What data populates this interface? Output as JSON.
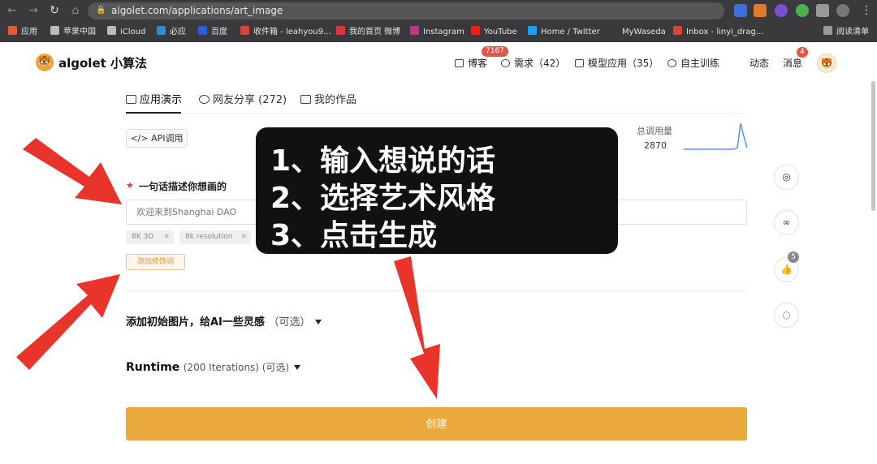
{
  "browser": {
    "url": "algolet.com/applications/art_image",
    "bookmarks": [
      "应用",
      "苹果中国",
      "iCloud",
      "必应",
      "百度",
      "收件箱 - leahyou9...",
      "我的首页 微博",
      "Instagram",
      "YouTube",
      "Home / Twitter",
      "MyWaseda",
      "Inbox - linyi_drag...",
      "阅读清单"
    ]
  },
  "header": {
    "brand": "algolet 小算法",
    "nav": {
      "blog": "博客",
      "blog_badge": "7167",
      "demand": "需求（42）",
      "models": "模型应用（35）",
      "training": "自主训练",
      "activity": "动态",
      "messages": "消息",
      "messages_badge": "4"
    }
  },
  "tabs": {
    "demo": "应用演示",
    "share": "网友分享 (272)",
    "works": "我的作品"
  },
  "api_button": "API调用",
  "usage": {
    "label": "总调用量",
    "value": "2870"
  },
  "form": {
    "required_mark": "★",
    "prompt_label": "一句话描述你想画的",
    "prompt_value": "欢迎来到Shanghai DAO",
    "chips": [
      "8K 3D",
      "8k resolution"
    ],
    "chip_close": "×",
    "add_modifier": "添加修饰词",
    "init_image_label": "添加初始图片，给AI一些灵感",
    "init_image_optional": "（可选）",
    "runtime_label": "Runtime",
    "runtime_detail": "(200 Iterations) (可选)",
    "create_button": "创建"
  },
  "side": {
    "like_count": "5"
  },
  "overlay": {
    "line1": "1、输入想说的话",
    "line2": "2、选择艺术风格",
    "line3": "3、点击生成"
  },
  "colors": {
    "accent": "#e9a93d",
    "arrow": "#e8342a",
    "overlay_bg": "#111111"
  }
}
